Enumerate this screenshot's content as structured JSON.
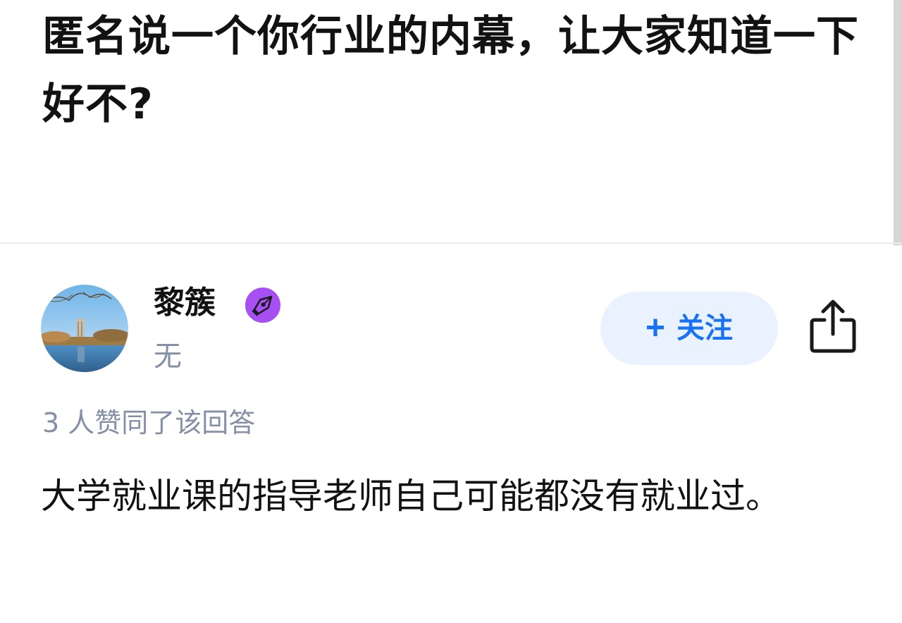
{
  "question": {
    "title": "匿名说一个你行业的内幕，让大家知道一下好不?"
  },
  "answer": {
    "author": {
      "name": "黎簇",
      "bio": "无",
      "avatar_icon": "avatar-landscape-photo",
      "badge_icon": "pen-nib-badge-icon",
      "badge_color": "#a64ff2"
    },
    "follow_button": {
      "plus": "+",
      "label": "关注"
    },
    "share_icon": "share-icon",
    "vote_summary": "3 人赞同了该回答",
    "content": "大学就业课的指导老师自己可能都没有就业过。"
  },
  "colors": {
    "accent": "#1772f6",
    "follow_bg": "#ebf2ff",
    "muted_text": "#8590a6",
    "primary_text": "#121212"
  }
}
